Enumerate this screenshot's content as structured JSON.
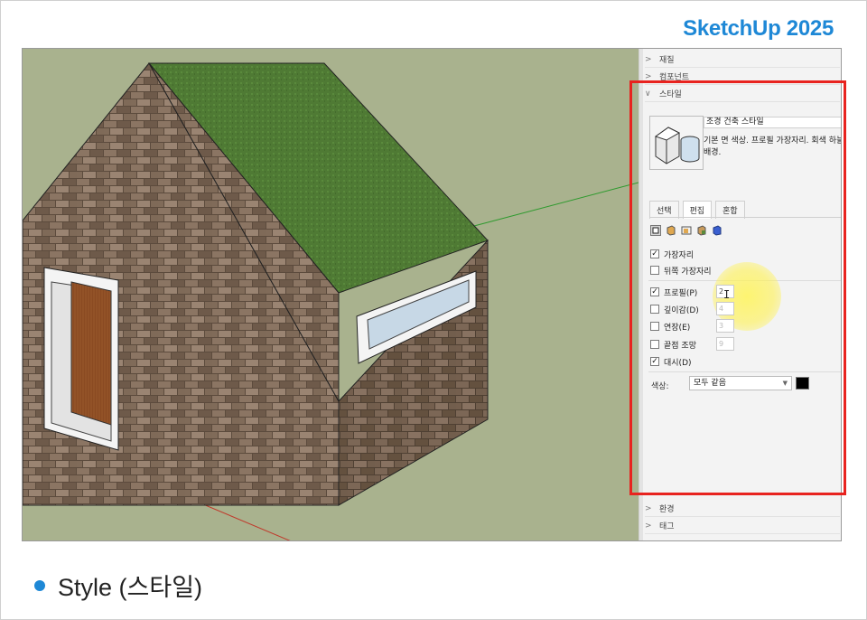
{
  "brand": {
    "title": "SketchUp 2025"
  },
  "trays": {
    "top": [
      {
        "label": "재질"
      },
      {
        "label": "컴포넌트"
      },
      {
        "label": "스타일"
      }
    ],
    "bottom": [
      {
        "label": "환경"
      },
      {
        "label": "태그"
      }
    ]
  },
  "style": {
    "name": "조경 건축 스타일",
    "description_line1": "기본 면 색상. 프로필 가장자리. 회색 하늘",
    "description_line2": "배경."
  },
  "tabs": [
    {
      "label": "선택",
      "active": false
    },
    {
      "label": "편집",
      "active": true
    },
    {
      "label": "혼합",
      "active": false
    }
  ],
  "edge_settings": {
    "edges": {
      "label": "가장자리",
      "checked": true
    },
    "back_edges": {
      "label": "뒤쪽 가장자리",
      "checked": false
    },
    "profiles": {
      "label": "프로필(P)",
      "checked": true,
      "value": "2"
    },
    "depth_cue": {
      "label": "깊이감(D)",
      "checked": false,
      "value": "4"
    },
    "extension": {
      "label": "연장(E)",
      "checked": false,
      "value": "3"
    },
    "endpoints": {
      "label": "끝점 조망",
      "checked": false,
      "value": "9"
    },
    "dashes": {
      "label": "대시(D)",
      "checked": true
    }
  },
  "color": {
    "label": "색상:",
    "selected": "모두 같음",
    "swatch": "#000000"
  },
  "caption": {
    "text": "Style (스타일)"
  },
  "colors": {
    "accent": "#1e88d6",
    "highlight_box": "#e8231f",
    "sky_ground": "#a9b28e",
    "roof": "#4f7a34",
    "brick": "#7b6655",
    "door": "#8a4a22"
  }
}
